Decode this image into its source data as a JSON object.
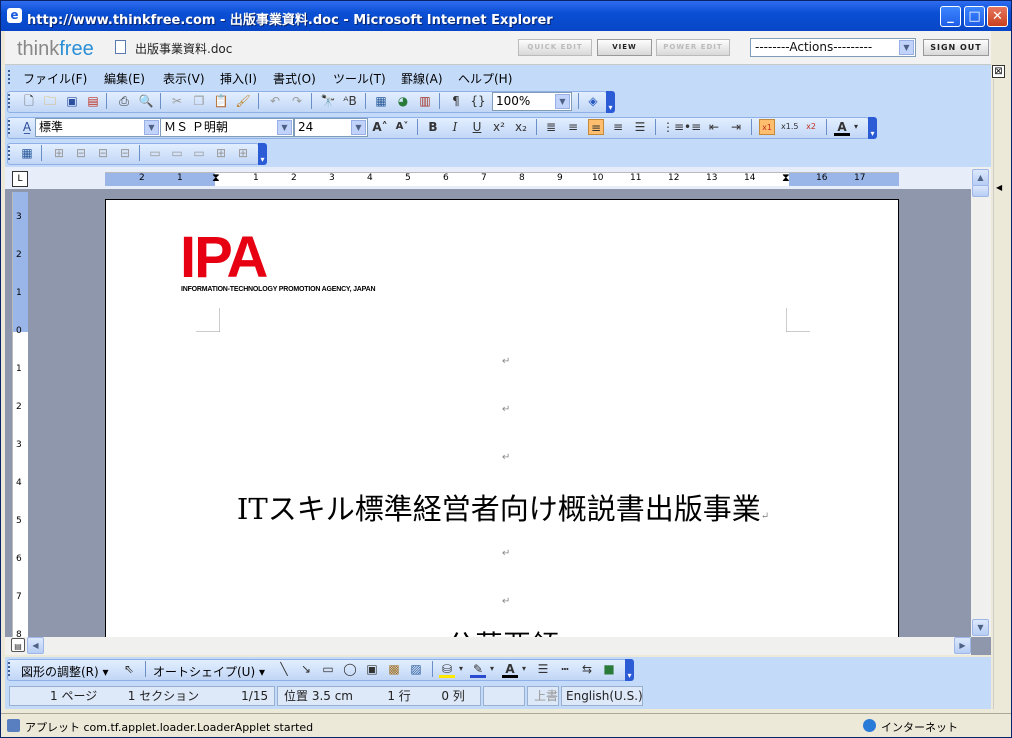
{
  "window": {
    "title": "http://www.thinkfree.com - 出版事業資料.doc - Microsoft Internet Explorer"
  },
  "thinkfree": {
    "logo_left": "think",
    "logo_right": "free",
    "doc_name": "出版事業資料.doc",
    "quick_edit": "QUICK EDIT",
    "view": "VIEW",
    "power_edit": "POWER EDIT",
    "actions": "--------Actions---------",
    "sign_out": "SIGN OUT"
  },
  "menu": [
    "ファイル(F)",
    "編集(E)",
    "表示(V)",
    "挿入(I)",
    "書式(O)",
    "ツール(T)",
    "罫線(A)",
    "ヘルプ(H)"
  ],
  "toolbar": {
    "zoom": "100%",
    "style": "標準",
    "font": "ＭＳ Ｐ明朝",
    "size": "24"
  },
  "ruler": {
    "h_ticks": [
      "2",
      "1",
      "1",
      "2",
      "3",
      "4",
      "5",
      "6",
      "7",
      "8",
      "9",
      "10",
      "11",
      "12",
      "13",
      "14",
      "15",
      "16",
      "17"
    ],
    "v_ticks": [
      "3",
      "2",
      "1",
      "0",
      "1",
      "2",
      "3",
      "4",
      "5",
      "6",
      "7",
      "8"
    ]
  },
  "document": {
    "logo_text": "IPA",
    "logo_sub": "INFORMATION-TECHNOLOGY PROMOTION AGENCY, JAPAN",
    "title": "ITスキル標準経営者向け概説書出版事業",
    "para_mark": "↵",
    "partial_line": "公募要領"
  },
  "drawbar": {
    "adjust": "図形の調整(R)",
    "autoshape": "オートシェイプ(U)"
  },
  "status": {
    "page": "1 ページ",
    "section": "1 セクション",
    "pages": "1/15",
    "position": "位置 3.5 cm",
    "line": "1 行",
    "col": "0 列",
    "overwrite": "上書",
    "language": "English(U.S.)"
  },
  "ie_status": {
    "message": "アプレット com.tf.applet.loader.LoaderApplet started",
    "zone": "インターネット"
  }
}
